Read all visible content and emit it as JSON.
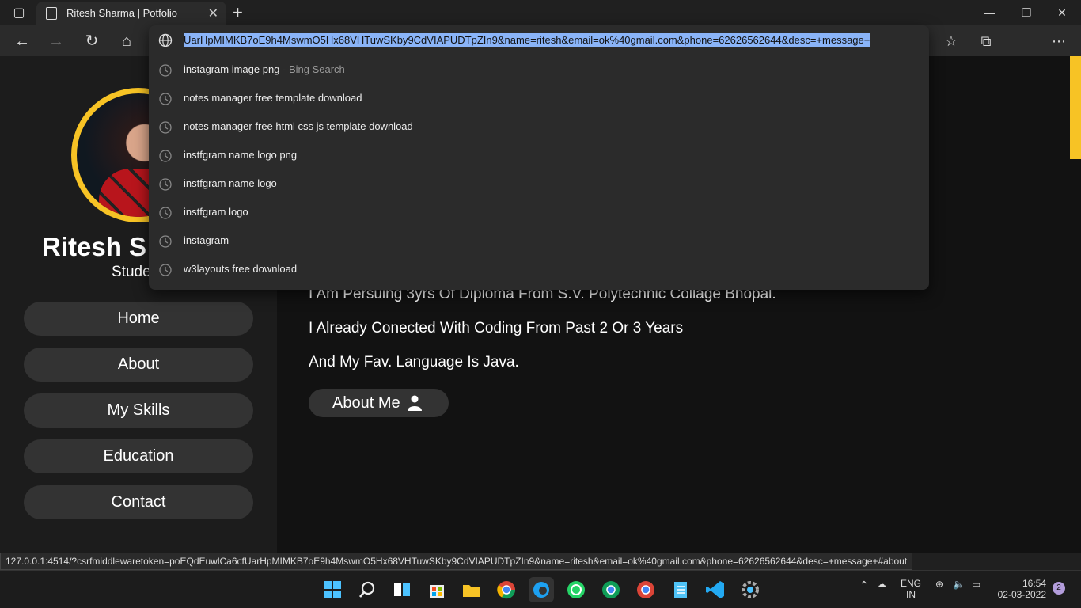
{
  "browser": {
    "tab_title": "Ritesh Sharma | Potfolio",
    "address_url": "UarHpMIMKB7oE9h4MswmO5Hx68VHTuwSKby9CdVIAPUDTpZIn9&name=ritesh&email=ok%40gmail.com&phone=62626562644&desc=+message+",
    "status_url": "127.0.0.1:4514/?csrfmiddlewaretoken=poEQdEuwlCa6cfUarHpMIMKB7oE9h4MswmO5Hx68VHTuwSKby9CdVIAPUDTpZIn9&name=ritesh&email=ok%40gmail.com&phone=62626562644&desc=+message+#about",
    "suggestions": [
      {
        "text": "instagram image png",
        "sub": " - Bing Search"
      },
      {
        "text": "notes manager free template download",
        "sub": ""
      },
      {
        "text": "notes manager free html css js template download",
        "sub": ""
      },
      {
        "text": "instfgram name logo png",
        "sub": ""
      },
      {
        "text": "instfgram name logo",
        "sub": ""
      },
      {
        "text": "instfgram logo",
        "sub": ""
      },
      {
        "text": "instagram",
        "sub": ""
      },
      {
        "text": "w3layouts free download",
        "sub": ""
      }
    ]
  },
  "site": {
    "profile_name": "Ritesh S",
    "profile_role": "Stude",
    "nav": [
      "Home",
      "About",
      "My Skills",
      "Education",
      "Contact"
    ],
    "lines": [
      "I Am Persuing 3yrs Of Diploma From S.V. Polytechnic Collage Bhopal.",
      "I Already Conected With Coding From Past 2 Or 3 Years",
      "And My Fav. Language Is Java."
    ],
    "about_button": "About Me",
    "accent_color": "#f7c325"
  },
  "taskbar": {
    "lang": "ENG",
    "region": "IN",
    "time": "16:54",
    "date": "02-03-2022",
    "notifications": "2"
  }
}
